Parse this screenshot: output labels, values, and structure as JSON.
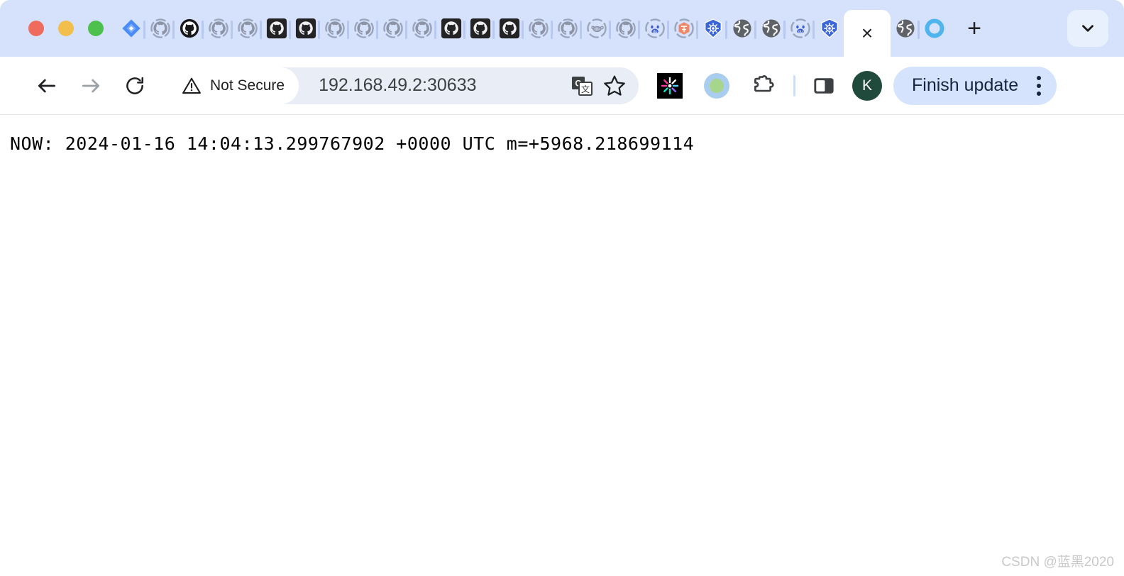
{
  "window": {
    "traffic_lights": [
      {
        "name": "close",
        "color": "#ef6b5d"
      },
      {
        "name": "minimize",
        "color": "#f2be4c"
      },
      {
        "name": "maximize",
        "color": "#4dc14c"
      }
    ],
    "tabstrip_bg": "#d6e2fb"
  },
  "tabstrip": {
    "tabs": [
      {
        "favicon": "jira-icon"
      },
      {
        "favicon": "github-loading-icon"
      },
      {
        "favicon": "github-dark-circle-icon"
      },
      {
        "favicon": "github-loading-icon"
      },
      {
        "favicon": "github-loading-icon"
      },
      {
        "favicon": "github-square-icon"
      },
      {
        "favicon": "github-square-icon"
      },
      {
        "favicon": "github-loading-icon"
      },
      {
        "favicon": "github-loading-icon"
      },
      {
        "favicon": "github-loading-icon"
      },
      {
        "favicon": "github-loading-icon"
      },
      {
        "favicon": "github-square-icon"
      },
      {
        "favicon": "github-square-icon"
      },
      {
        "favicon": "github-square-icon"
      },
      {
        "favicon": "github-loading-icon"
      },
      {
        "favicon": "github-loading-icon"
      },
      {
        "favicon": "bee-loading-icon"
      },
      {
        "favicon": "github-loading-icon"
      },
      {
        "favicon": "baidu-loading-icon"
      },
      {
        "favicon": "orange-hexagon-loading-icon"
      },
      {
        "favicon": "kubernetes-icon"
      },
      {
        "favicon": "globe-icon"
      },
      {
        "favicon": "globe-icon"
      },
      {
        "favicon": "baidu-loading-icon"
      },
      {
        "favicon": "kubernetes-icon"
      }
    ],
    "active_tab": {
      "close_label": "×"
    },
    "tabs_after_active": [
      {
        "favicon": "globe-icon"
      },
      {
        "favicon": "blue-ring-icon"
      }
    ],
    "new_tab_label": "+",
    "tab_search_icon": "chevron-down-icon"
  },
  "toolbar": {
    "back_icon": "arrow-left-icon",
    "forward_icon": "arrow-right-icon",
    "reload_icon": "reload-icon",
    "security": {
      "icon": "warning-triangle-icon",
      "label": "Not Secure"
    },
    "url": "192.168.49.2:30633",
    "translate_icon": "google-translate-icon",
    "bookmark_icon": "star-icon",
    "extensions": [
      {
        "icon": "sparkle-extension-icon"
      },
      {
        "icon": "green-circle-extension-icon"
      },
      {
        "icon": "puzzle-piece-icon"
      }
    ],
    "side_panel_icon": "side-panel-icon",
    "profile": {
      "initial": "K",
      "color": "#1f4a3c"
    },
    "update": {
      "label": "Finish update",
      "menu_icon": "kebab-menu-icon",
      "bg": "#d5e3fd"
    }
  },
  "page": {
    "content": "NOW: 2024-01-16 14:04:13.299767902 +0000 UTC m=+5968.218699114",
    "watermark": "CSDN @蓝黑2020"
  }
}
